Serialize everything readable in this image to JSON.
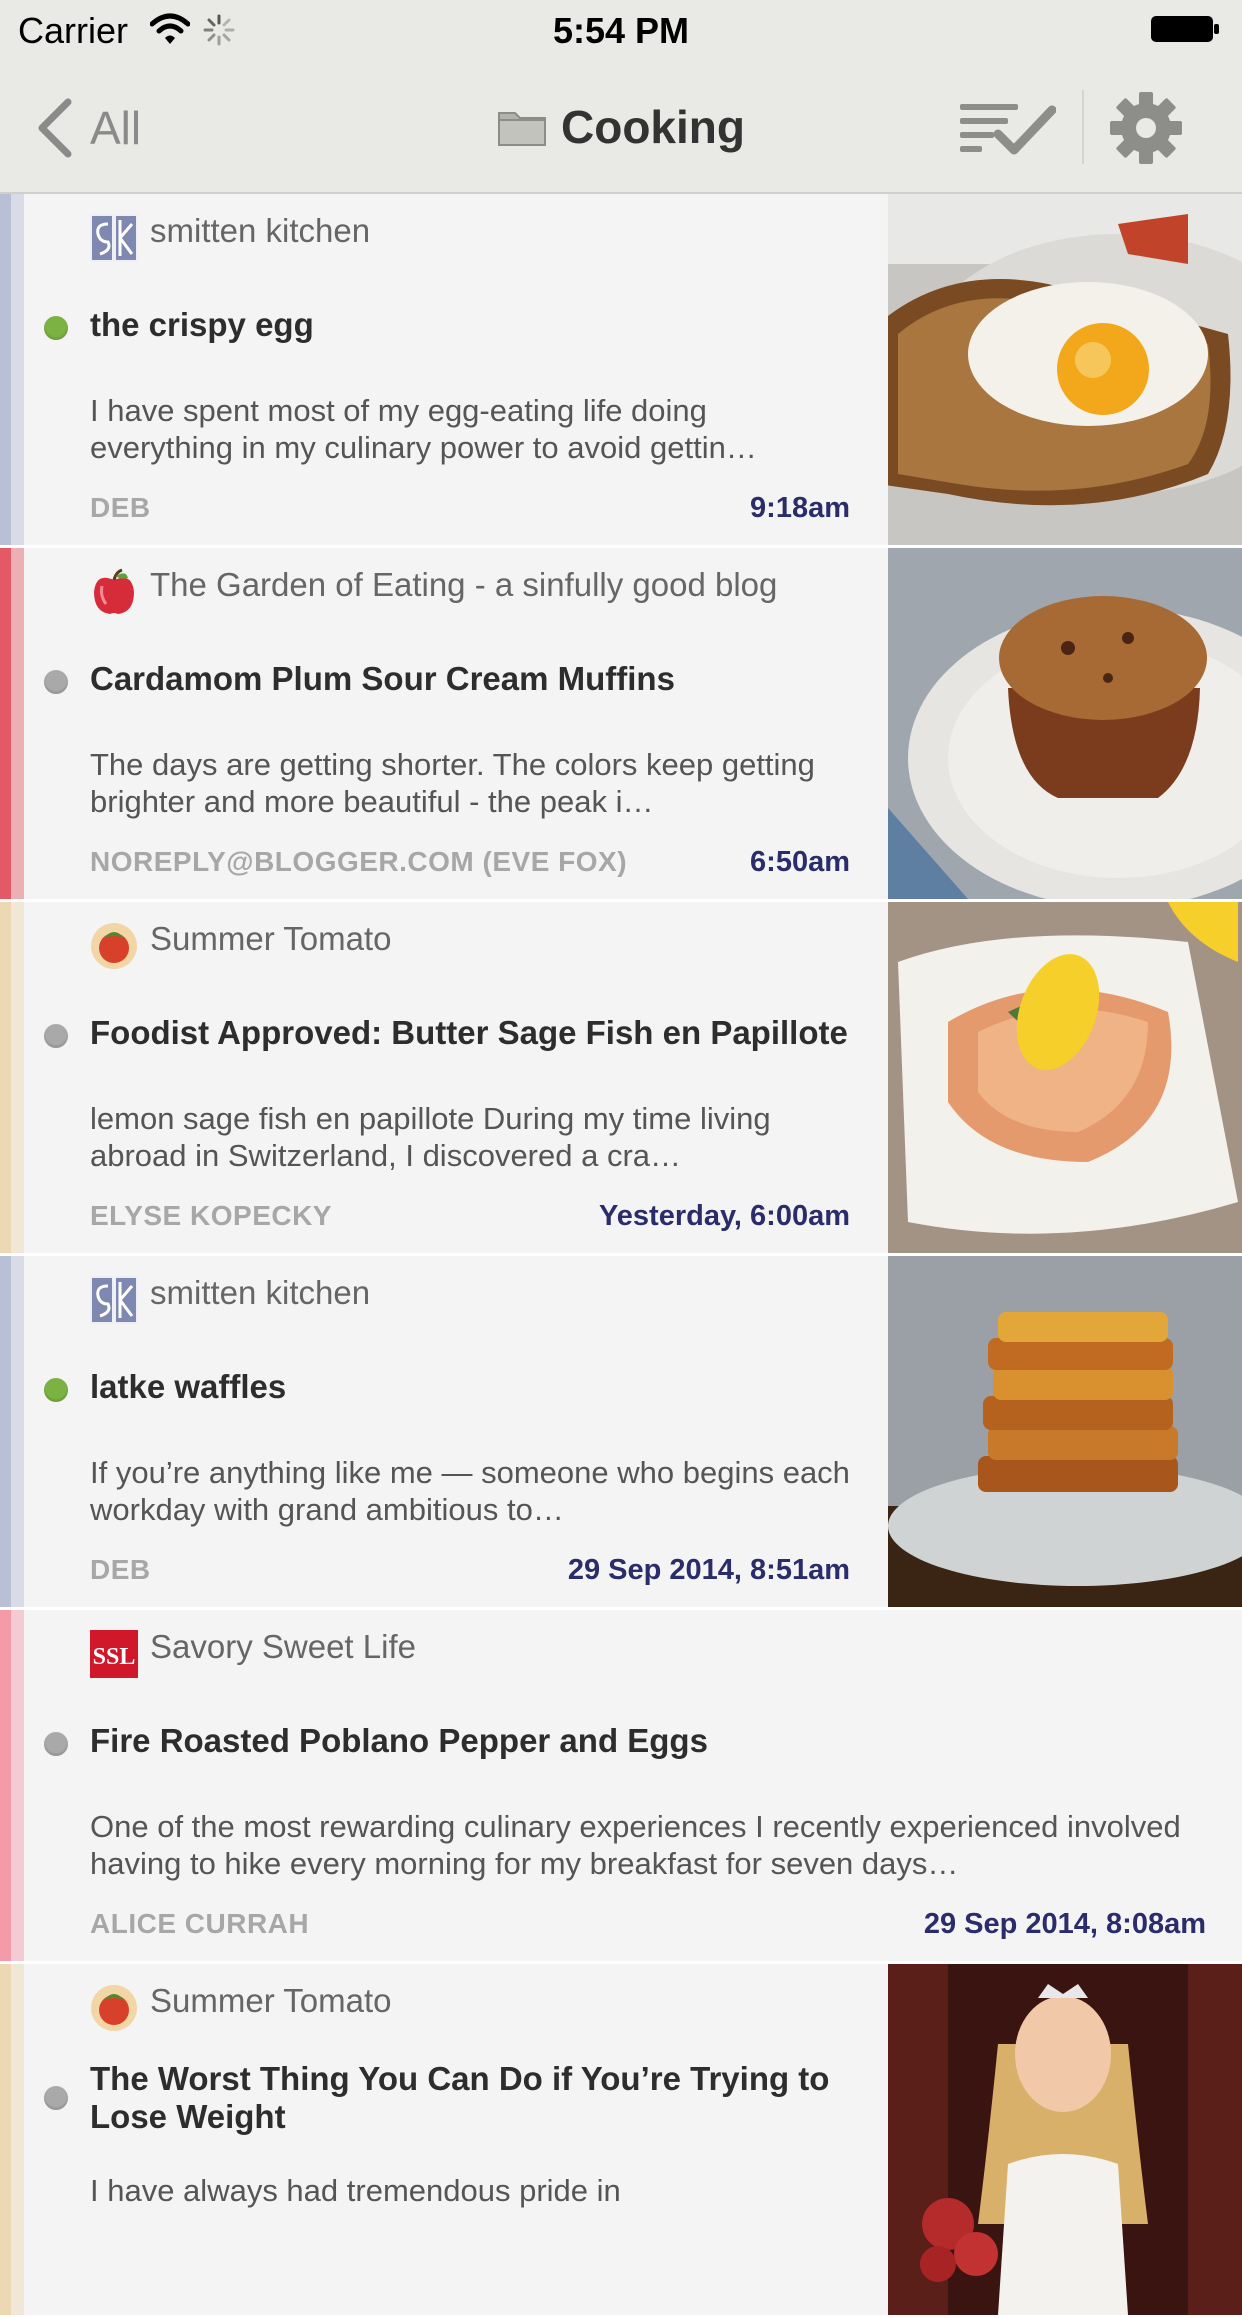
{
  "status_bar": {
    "carrier": "Carrier",
    "time": "5:54 PM"
  },
  "nav": {
    "back_label": "All",
    "title": "Cooking"
  },
  "colors": {
    "accent_date": "#2a2d6a",
    "unread_dot": "#7bb241",
    "read_dot": "#a9a9a9"
  },
  "stories": [
    {
      "feed": "smitten kitchen",
      "feed_icon": "smitten-kitchen-icon",
      "unread": true,
      "title": "the crispy egg",
      "summary": "I have spent most of my egg-eating life doing everything in my culinary power to avoid gettin…",
      "author": "DEB",
      "date": "9:18am",
      "bar_color": "#b9bfd4",
      "thumbnail": "fried-egg-on-toast"
    },
    {
      "feed": "The Garden of Eating - a sinfully good blog",
      "feed_icon": "apple-icon",
      "unread": false,
      "title": "Cardamom Plum Sour Cream Muffins",
      "summary": "The days are getting shorter. The colors keep getting brighter and more beautiful - the peak i…",
      "author": "NOREPLY@BLOGGER.COM (EVE FOX)",
      "date": "6:50am",
      "bar_color": "#e35a66",
      "thumbnail": "muffin-on-plate"
    },
    {
      "feed": "Summer Tomato",
      "feed_icon": "tomato-icon",
      "unread": false,
      "title": "Foodist Approved: Butter Sage Fish en Papillote",
      "summary": "lemon sage fish en papillote   During my time living abroad in Switzerland, I discovered a cra…",
      "author": "ELYSE KOPECKY",
      "date": "Yesterday, 6:00am",
      "bar_color": "#ecd8b2",
      "thumbnail": "fish-in-parchment"
    },
    {
      "feed": "smitten kitchen",
      "feed_icon": "smitten-kitchen-icon",
      "unread": true,
      "title": "latke waffles",
      "summary": "If you’re anything like me — someone who begins each workday with grand ambitious to…",
      "author": "DEB",
      "date": "29 Sep 2014, 8:51am",
      "bar_color": "#b9bfd4",
      "thumbnail": "stack-of-waffles"
    },
    {
      "feed": "Savory Sweet Life",
      "feed_icon": "ssl-icon",
      "unread": false,
      "title": "Fire Roasted Poblano Pepper and Eggs",
      "summary": "One of the most rewarding culinary experiences I recently experienced involved having to hike every morning for my breakfast for seven days…",
      "author": "ALICE CURRAH",
      "date": "29 Sep 2014, 8:08am",
      "bar_color": "#f49aa8",
      "thumbnail": ""
    },
    {
      "feed": "Summer Tomato",
      "feed_icon": "tomato-icon",
      "unread": false,
      "title": "The Worst Thing You Can Do if You’re Trying to Lose Weight",
      "summary": "I have always had tremendous pride in",
      "author": "",
      "date": "",
      "bar_color": "#ecd8b2",
      "thumbnail": "girl-with-tiara"
    }
  ]
}
